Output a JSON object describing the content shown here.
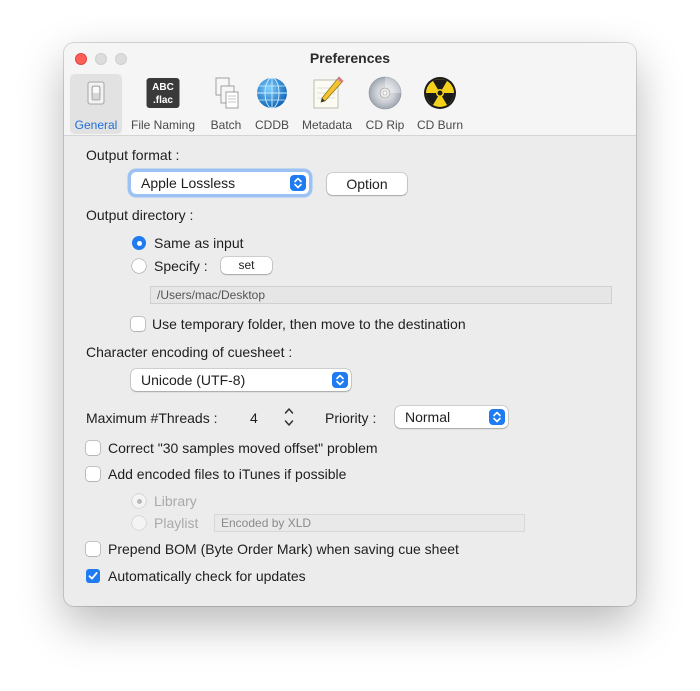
{
  "window": {
    "title": "Preferences"
  },
  "tabs": [
    {
      "id": "general",
      "label": "General",
      "icon": "switch-icon",
      "active": true
    },
    {
      "id": "file-naming",
      "label": "File Naming",
      "icon": "abc-flac-icon",
      "icon_text_1": "ABC",
      "icon_text_2": ".flac"
    },
    {
      "id": "batch",
      "label": "Batch",
      "icon": "documents-stack-icon"
    },
    {
      "id": "cddb",
      "label": "CDDB",
      "icon": "globe-icon"
    },
    {
      "id": "metadata",
      "label": "Metadata",
      "icon": "pencil-note-icon"
    },
    {
      "id": "cd-rip",
      "label": "CD Rip",
      "icon": "cd-disc-icon"
    },
    {
      "id": "cd-burn",
      "label": "CD Burn",
      "icon": "radiation-icon"
    }
  ],
  "general": {
    "output_format_label": "Output format :",
    "output_format_value": "Apple Lossless",
    "option_button": "Option",
    "output_directory_label": "Output directory :",
    "same_as_input": "Same as input",
    "same_as_input_selected": true,
    "specify": "Specify :",
    "set_button": "set",
    "directory_path": "/Users/mac/Desktop",
    "temp_folder": "Use temporary folder, then move to the destination",
    "temp_folder_checked": false,
    "cuesheet_encoding_label": "Character encoding of cuesheet :",
    "cuesheet_encoding_value": "Unicode (UTF-8)",
    "threads_label": "Maximum #Threads :",
    "threads_value": "4",
    "priority_label": "Priority :",
    "priority_value": "Normal",
    "correct_offset": "Correct \"30 samples moved offset\" problem",
    "correct_offset_checked": false,
    "add_itunes": "Add encoded files to iTunes if possible",
    "add_itunes_checked": false,
    "library": "Library",
    "playlist": "Playlist",
    "playlist_name": "Encoded by XLD",
    "prepend_bom": "Prepend BOM (Byte Order Mark) when saving cue sheet",
    "prepend_bom_checked": false,
    "auto_update": "Automatically check for updates",
    "auto_update_checked": true
  },
  "colors": {
    "accent": "#1f7bf2",
    "active_tab_label": "#1f6fd8",
    "close_button": "#fe5f57"
  }
}
